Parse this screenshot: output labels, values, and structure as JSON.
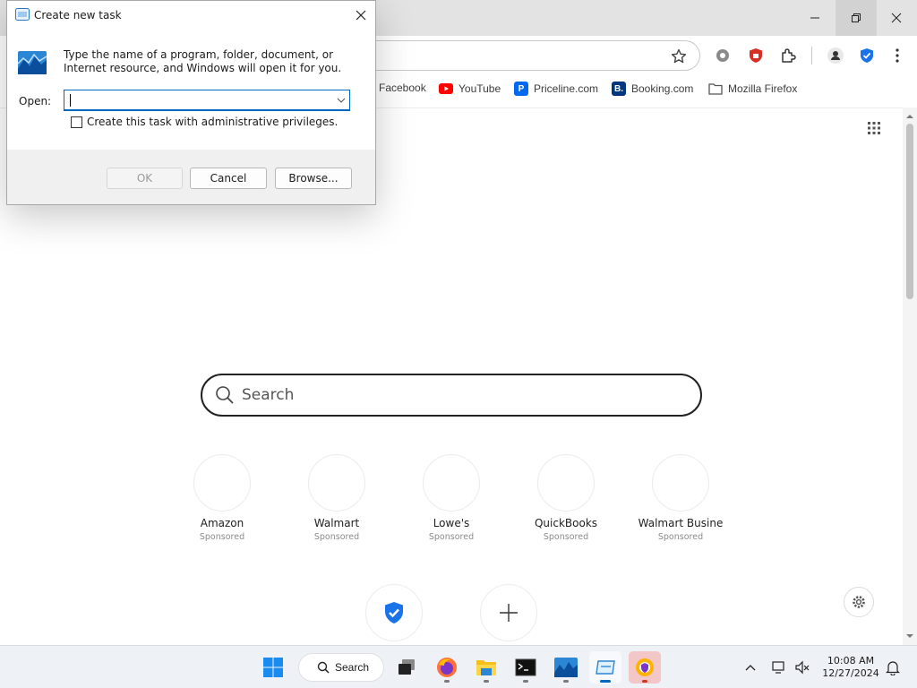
{
  "dialog": {
    "title": "Create new task",
    "description": "Type the name of a program, folder, document, or Internet resource, and Windows will open it for you.",
    "open_label": "Open:",
    "open_value": "",
    "checkbox_label": "Create this task with administrative privileges.",
    "checkbox_checked": false,
    "ok_label": "OK",
    "cancel_label": "Cancel",
    "browse_label": "Browse..."
  },
  "bookmarks": [
    {
      "label": "Facebook"
    },
    {
      "label": "YouTube",
      "icon": "youtube-icon",
      "color": "#ff0000"
    },
    {
      "label": "Priceline.com",
      "icon": "priceline-icon",
      "color": "#0068ef",
      "letter": "P"
    },
    {
      "label": "Booking.com",
      "icon": "booking-icon",
      "color": "#003580",
      "letter": "B."
    },
    {
      "label": "Mozilla Firefox",
      "icon": "folder-icon"
    }
  ],
  "newtab": {
    "search_placeholder": "Search",
    "tiles": [
      {
        "name": "Amazon",
        "sub": "Sponsored"
      },
      {
        "name": "Walmart",
        "sub": "Sponsored"
      },
      {
        "name": "Lowe's",
        "sub": "Sponsored"
      },
      {
        "name": "QuickBooks",
        "sub": "Sponsored"
      },
      {
        "name": "Walmart Busine",
        "sub": "Sponsored"
      }
    ]
  },
  "taskbar": {
    "search_label": "Search",
    "time": "10:08 AM",
    "date": "12/27/2024"
  },
  "colors": {
    "accent": "#0067c0",
    "shield": "#1a73e8"
  }
}
